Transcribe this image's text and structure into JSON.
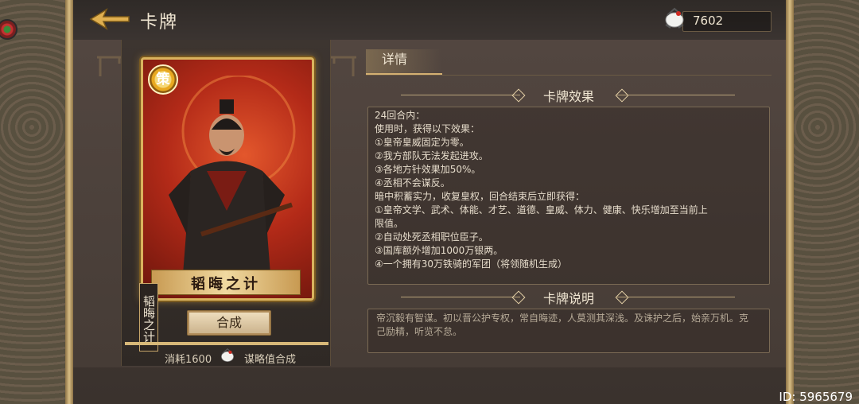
{
  "header": {
    "title": "卡牌",
    "currency_value": "7602"
  },
  "card": {
    "badge": "策",
    "name": "韬晦之计",
    "vertical_label": "韬晦之计",
    "synthesize_label": "合成",
    "cost_text": "消耗1600",
    "cost_suffix": "谋略值合成",
    "progress_fraction": 1.0
  },
  "details": {
    "tab_label": "详情",
    "effects_title": "卡牌效果",
    "effects_lines": [
      "24回合内：",
      "使用时，获得以下效果：",
      "①皇帝皇威固定为零。",
      "②我方部队无法发起进攻。",
      "③各地方针效果加50%。",
      "④丞相不会谋反。",
      "暗中积蓄实力，收复皇权，回合结束后立即获得：",
      "①皇帝文学、武术、体能、才艺、道德、皇威、体力、健康、快乐增加至当前上",
      "限值。",
      "②自动处死丞相职位臣子。",
      "③国库额外增加1000万银两。",
      "④一个拥有30万铁骑的军团（将领随机生成）"
    ],
    "description_title": "卡牌说明",
    "description_text": "帝沉毅有智谋。初以晋公护专权，常自晦迹，人莫测其深浅。及诛护之后，始亲万机。克己励精，听览不怠。"
  },
  "footer": {
    "id_text": "ID: 5965679"
  },
  "colors": {
    "accent_gold": "#d9b35e",
    "card_red": "#b32a18",
    "text_light": "#f0e6d2"
  },
  "icons": [
    "back-arrow-icon",
    "crane-currency-icon",
    "close-ring-icon",
    "strategy-badge-icon",
    "diamond-ornament-icon"
  ]
}
